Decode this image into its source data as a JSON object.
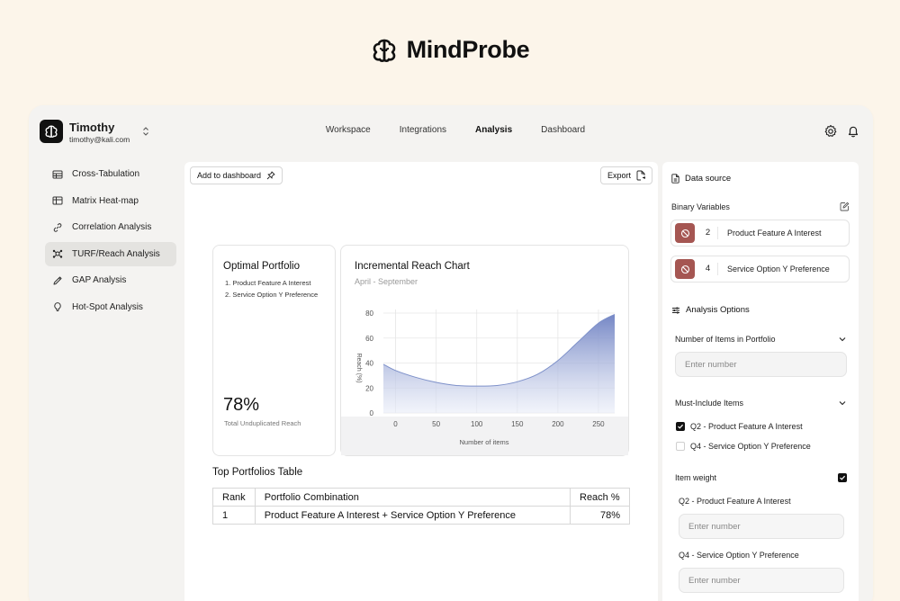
{
  "brand": {
    "name": "MindProbe"
  },
  "user": {
    "name": "Timothy",
    "email": "timothy@kali.com"
  },
  "nav": {
    "items": [
      "Workspace",
      "Integrations",
      "Analysis",
      "Dashboard"
    ],
    "active": "Analysis"
  },
  "sidebar": {
    "items": [
      {
        "label": "Cross-Tabulation",
        "icon": "table-icon"
      },
      {
        "label": "Matrix Heat-map",
        "icon": "grid-icon"
      },
      {
        "label": "Correlation Analysis",
        "icon": "link-icon"
      },
      {
        "label": "TURF/Reach Analysis",
        "icon": "network-icon"
      },
      {
        "label": "GAP Analysis",
        "icon": "pen-icon"
      },
      {
        "label": "Hot-Spot Analysis",
        "icon": "lightbulb-icon"
      }
    ],
    "active": "TURF/Reach Analysis"
  },
  "toolbar": {
    "add_label": "Add to dashboard",
    "export_label": "Export"
  },
  "optimal": {
    "title": "Optimal Portfolio",
    "items": [
      "1. Product Feature A Interest",
      "2. Service Option Y Preference"
    ],
    "value": "78%",
    "caption": "Total Unduplicated Reach"
  },
  "chart_card": {
    "title": "Incremental Reach Chart",
    "subtitle": "April - September"
  },
  "chart_data": {
    "type": "area",
    "title": "Incremental Reach Chart",
    "xlabel": "Number of items",
    "ylabel": "Reach (%)",
    "xlim": [
      -15,
      270
    ],
    "ylim": [
      0,
      80
    ],
    "xticks": [
      0,
      50,
      100,
      150,
      200,
      250
    ],
    "yticks": [
      0,
      20,
      40,
      60,
      80
    ],
    "grid": true,
    "color": "#7c8fcb",
    "x": [
      -15,
      0,
      25,
      50,
      75,
      100,
      125,
      150,
      175,
      200,
      225,
      250,
      270
    ],
    "y": [
      39,
      34,
      28.5,
      24.5,
      22,
      21.5,
      22,
      25,
      31,
      42,
      57,
      72,
      79
    ]
  },
  "table": {
    "title": "Top Portfolios Table",
    "headers": [
      "Rank",
      "Portfolio Combination",
      "Reach %"
    ],
    "rows": [
      [
        "1",
        "Product Feature A Interest + Service Option Y Preference",
        "78%"
      ]
    ]
  },
  "panel": {
    "data_source": "Data source",
    "binary_label": "Binary Variables",
    "variables": [
      {
        "num": "2",
        "name": "Product Feature A Interest"
      },
      {
        "num": "4",
        "name": "Service Option Y Preference"
      }
    ],
    "analysis_options": "Analysis Options",
    "items_label": "Number of Items in Portfolio",
    "items_placeholder": "Enter number",
    "must_include": "Must-Include Items",
    "must_items": [
      {
        "label": "Q2 - Product Feature A Interest",
        "checked": true
      },
      {
        "label": "Q4 - Service Option Y Preference",
        "checked": false
      }
    ],
    "item_weight": "Item weight",
    "weights": [
      {
        "label": "Q2 - Product Feature A Interest",
        "placeholder": "Enter number"
      },
      {
        "label": "Q4 - Service Option Y Preference",
        "placeholder": "Enter number"
      }
    ]
  },
  "colors": {
    "accent": "#a55652",
    "chart": "#7c8fcb",
    "background": "#fcf5ea"
  }
}
